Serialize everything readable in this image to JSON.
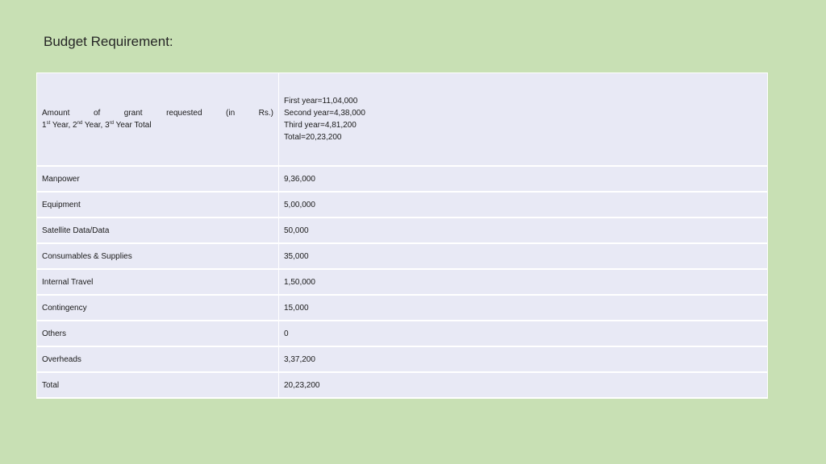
{
  "title": "Budget Requirement:",
  "header": {
    "label_words": [
      "Amount",
      "of",
      "grant",
      "requested",
      "(in",
      "Rs.)"
    ],
    "label_line2": {
      "n1": "1",
      "s1": "st",
      "t1": " Year, 2",
      "s2": "nd",
      "t2": " Year, 3",
      "s3": "rd",
      "t3": " Year Total"
    },
    "years": [
      "First year=11,04,000",
      "Second year=4,38,000",
      "Third year=4,81,200",
      "Total=20,23,200"
    ]
  },
  "rows": [
    {
      "label": "Manpower",
      "value": "9,36,000"
    },
    {
      "label": "Equipment",
      "value": "5,00,000"
    },
    {
      "label": "Satellite Data/Data",
      "value": "50,000"
    },
    {
      "label": "Consumables & Supplies",
      "value": "35,000"
    },
    {
      "label": "Internal Travel",
      "value": "1,50,000"
    },
    {
      "label": "Contingency",
      "value": "15,000"
    },
    {
      "label": "Others",
      "value": "0"
    },
    {
      "label": "Overheads",
      "value": "3,37,200"
    },
    {
      "label": "Total",
      "value": "20,23,200"
    }
  ]
}
